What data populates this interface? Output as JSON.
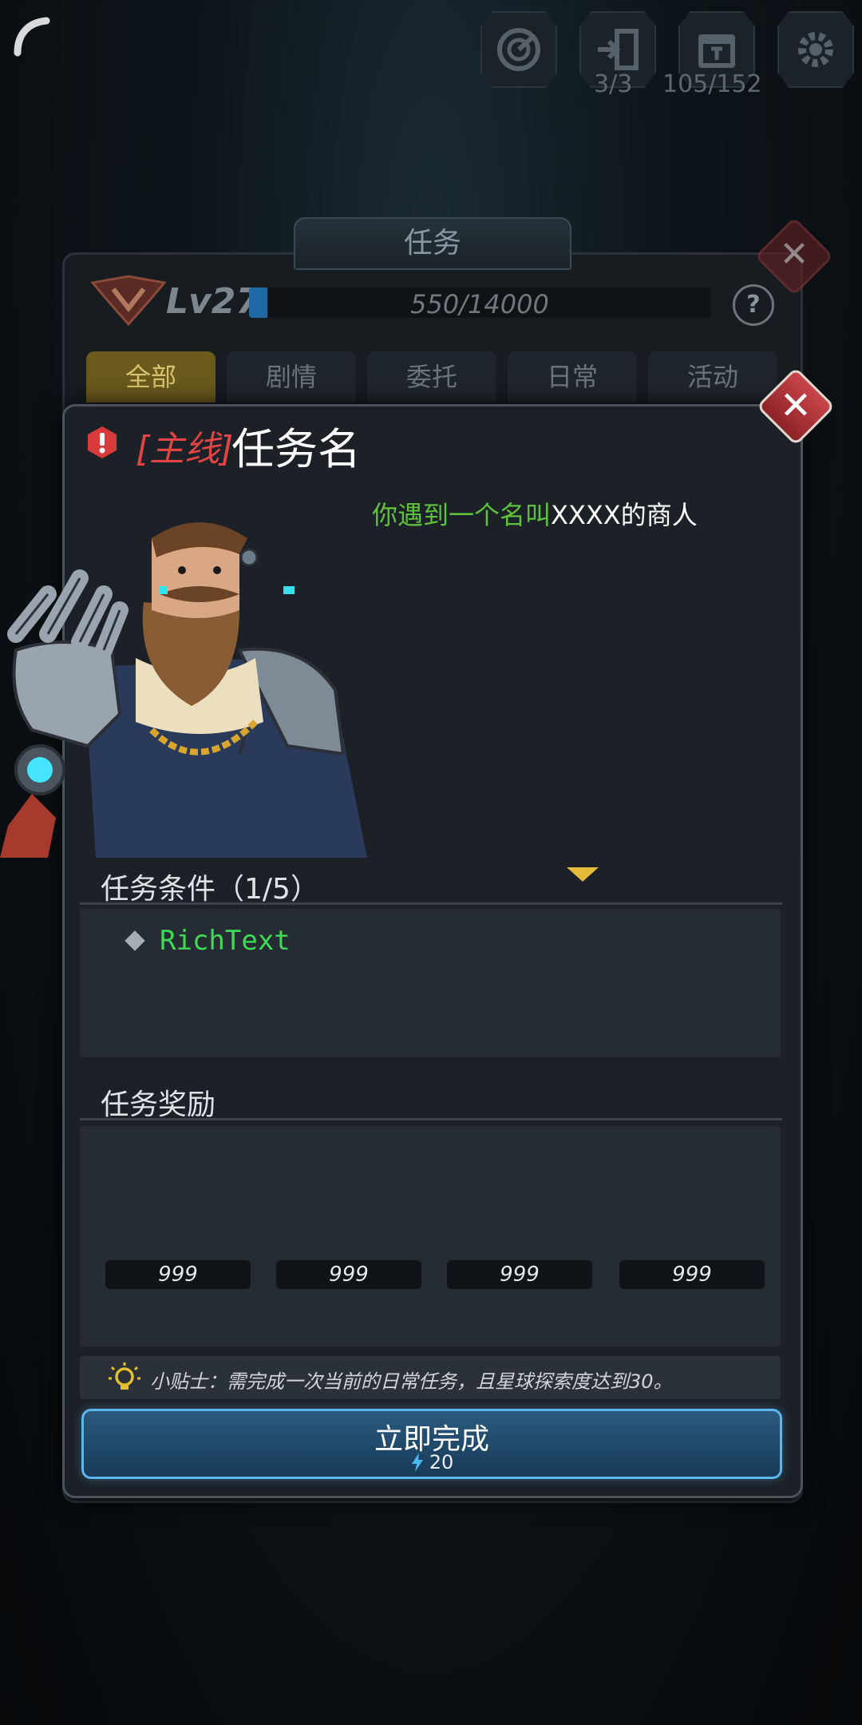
{
  "hud": {
    "count_a": "3/3",
    "count_b": "105/152"
  },
  "quest_panel": {
    "title": "任务",
    "level": "Lv27",
    "xp_text": "550/14000",
    "xp_fraction": 0.039,
    "help": "?",
    "tabs": [
      "全部",
      "剧情",
      "委托",
      "日常",
      "活动"
    ],
    "active_tab": 0
  },
  "detail": {
    "close": "✕",
    "tag": "[主线]",
    "name": "任务名",
    "desc_green": "你遇到一个名叫",
    "desc_white": "XXXX的商人",
    "conditions_title": "任务条件（1/5）",
    "condition_text": "RichText",
    "rewards_title": "任务奖励",
    "reward_counts": [
      "999",
      "999",
      "999",
      "999"
    ],
    "tip": "小贴士：需完成一次当前的日常任务，且星球探索度达到30。",
    "complete_label": "立即完成",
    "cost": "20"
  },
  "colors": {
    "accent_blue": "#5fb6ec",
    "tag_red": "#e04444",
    "desc_green": "#5ec23c",
    "condition_green": "#3ddc54",
    "active_tab": "#6b5a1c"
  }
}
